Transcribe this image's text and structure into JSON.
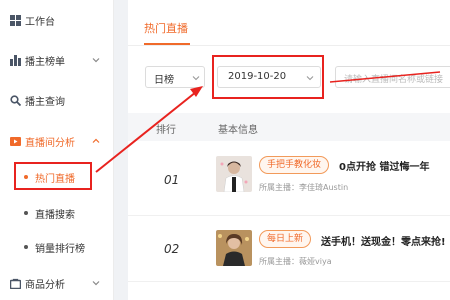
{
  "sidebar": {
    "items": [
      {
        "label": "工作台",
        "icon": "dashboard-icon"
      },
      {
        "label": "播主榜单",
        "icon": "bar-chart-icon"
      },
      {
        "label": "播主查询",
        "icon": "search-icon"
      },
      {
        "label": "直播间分析",
        "icon": "video-analysis-icon"
      },
      {
        "label": "商品分析",
        "icon": "goods-icon"
      }
    ],
    "subitems": [
      {
        "label": "热门直播"
      },
      {
        "label": "直播搜索"
      },
      {
        "label": "销量排行榜"
      }
    ]
  },
  "main": {
    "tab": "热门直播",
    "filter": {
      "period": "日榜",
      "date": "2019-10-20",
      "search_placeholder": "请输入直播间名称或链接"
    },
    "table": {
      "headers": [
        "排行",
        "基本信息"
      ],
      "rows": [
        {
          "rank": "01",
          "tag": "手把手教化妆",
          "title": "0点开抢 错过悔一年",
          "host": "所属主播：李佳琦Austin"
        },
        {
          "rank": "02",
          "tag": "每日上新",
          "title": "送手机！送现金！零点来抢!",
          "host": "所属主播：薇娅viya"
        }
      ]
    }
  },
  "colors": {
    "accent": "#f06a2a",
    "annotation": "#e8231f"
  }
}
